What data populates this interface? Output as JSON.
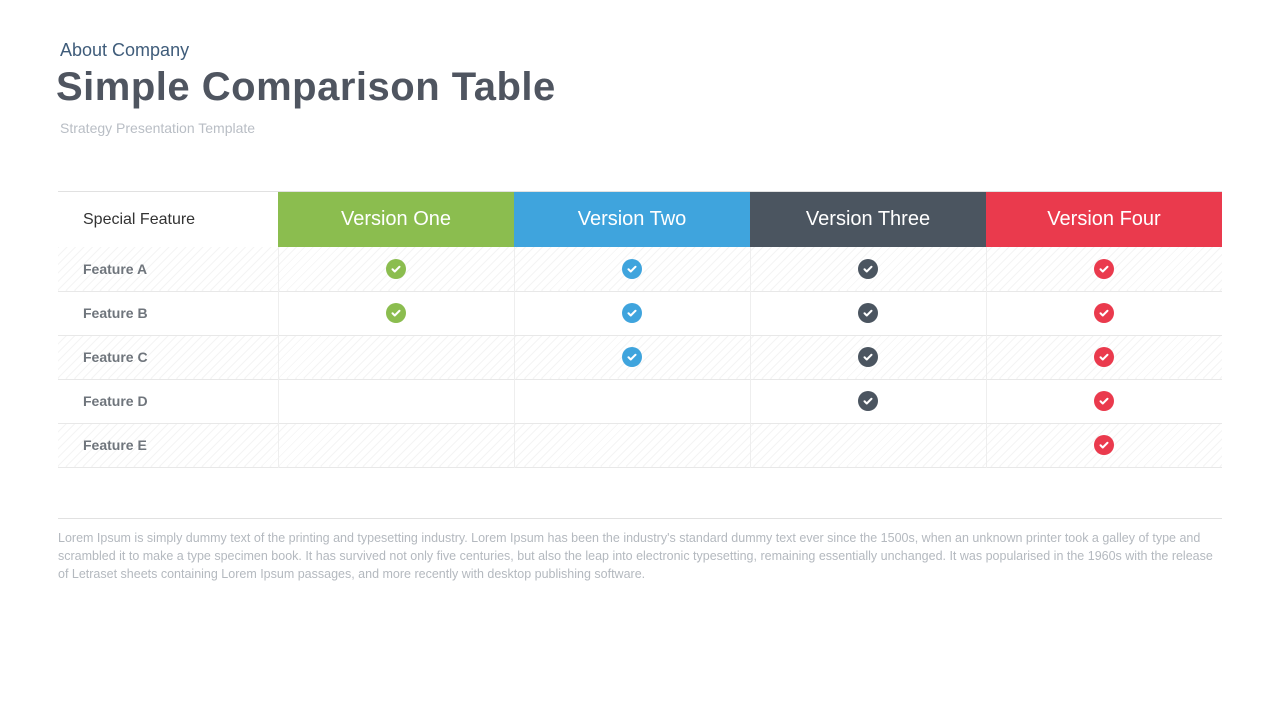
{
  "header": {
    "eyebrow": "About Company",
    "title": "Simple Comparison Table",
    "subtitle": "Strategy Presentation Template"
  },
  "table": {
    "feature_header": "Special Feature",
    "columns": [
      {
        "label": "Version One",
        "color_class": "c-green",
        "check_class": "chk-green"
      },
      {
        "label": "Version Two",
        "color_class": "c-blue",
        "check_class": "chk-blue"
      },
      {
        "label": "Version Three",
        "color_class": "c-dark",
        "check_class": "chk-dark"
      },
      {
        "label": "Version Four",
        "color_class": "c-red",
        "check_class": "chk-red"
      }
    ],
    "rows": [
      {
        "label": "Feature A",
        "hatched": true,
        "values": [
          true,
          true,
          true,
          true
        ]
      },
      {
        "label": "Feature B",
        "hatched": false,
        "values": [
          true,
          true,
          true,
          true
        ]
      },
      {
        "label": "Feature C",
        "hatched": true,
        "values": [
          false,
          true,
          true,
          true
        ]
      },
      {
        "label": "Feature D",
        "hatched": false,
        "values": [
          false,
          false,
          true,
          true
        ]
      },
      {
        "label": "Feature E",
        "hatched": true,
        "values": [
          false,
          false,
          false,
          true
        ]
      }
    ]
  },
  "footer": {
    "text": "Lorem Ipsum is simply dummy text of the printing and typesetting industry. Lorem Ipsum has been the industry's standard dummy text ever since the 1500s, when an unknown printer took a galley of type and scrambled it to make a type specimen book. It has survived not only five centuries, but also the leap into electronic typesetting, remaining essentially unchanged. It was popularised in the 1960s with the release of Letraset sheets containing Lorem Ipsum passages, and more recently with desktop publishing software."
  },
  "colors": {
    "green": "#8bbd4f",
    "blue": "#3fa4dd",
    "dark": "#4b5560",
    "red": "#ea3a4d"
  }
}
